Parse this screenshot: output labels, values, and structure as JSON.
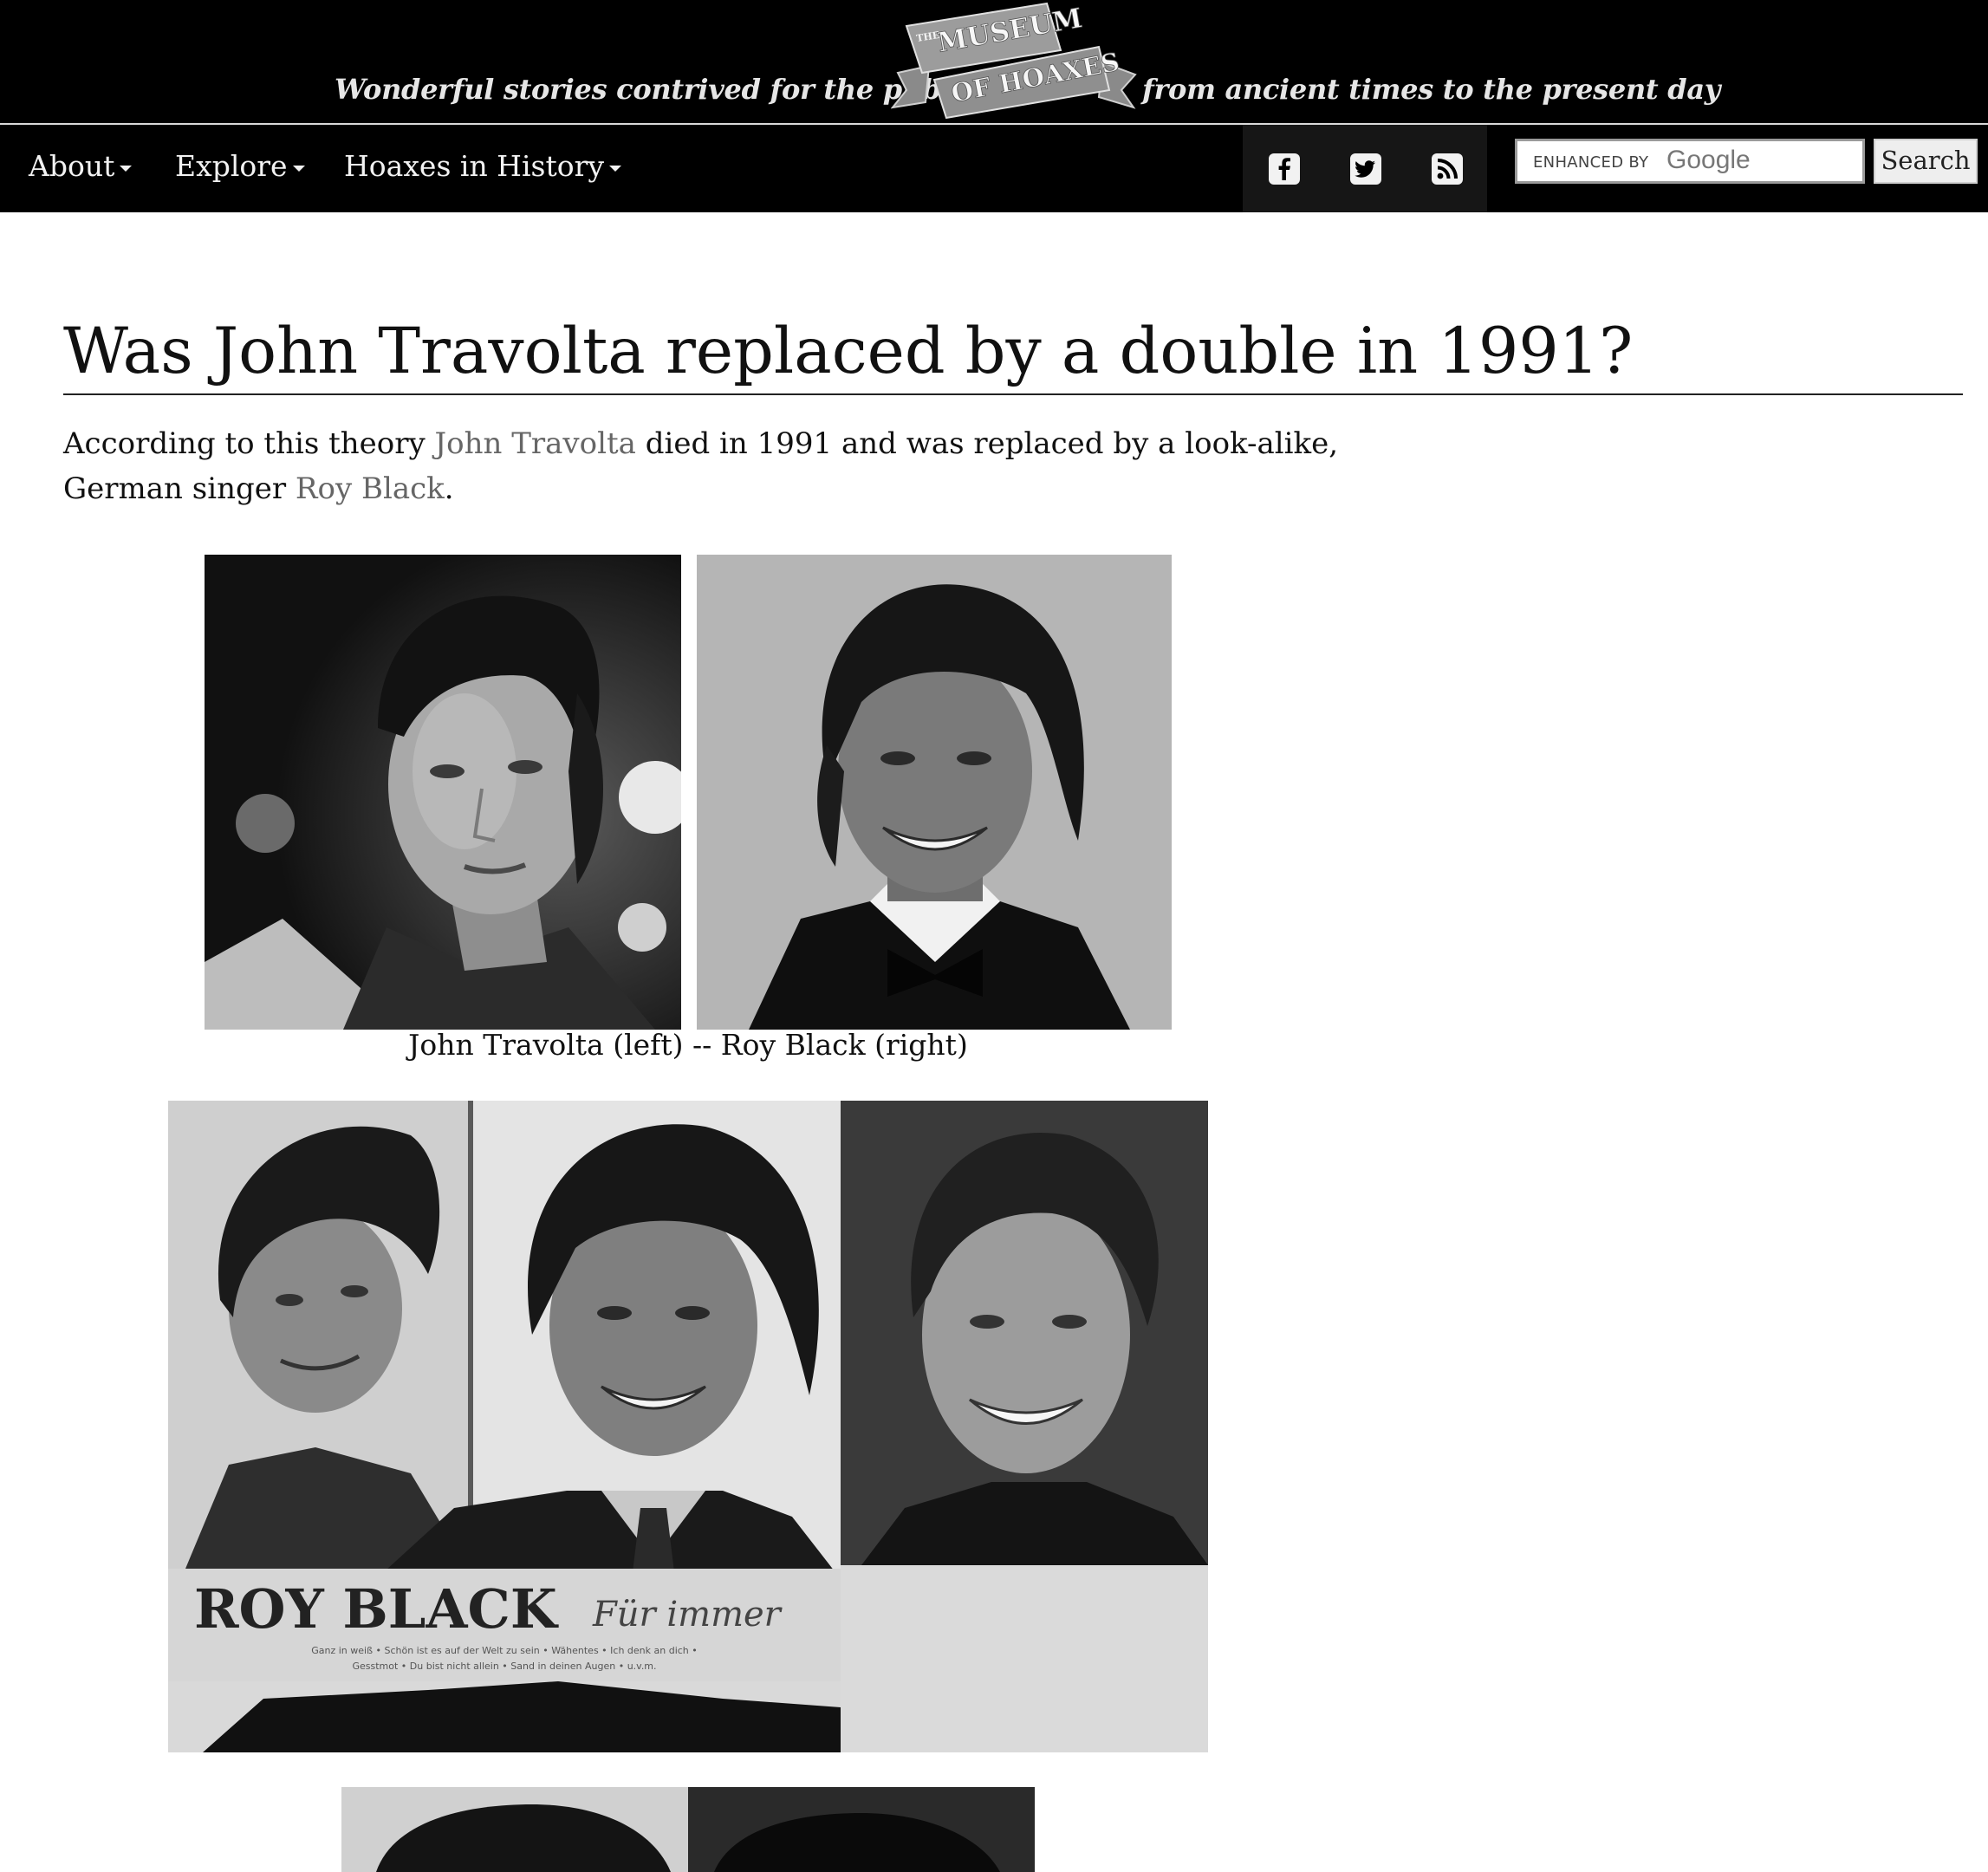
{
  "header": {
    "tagline_left": "Wonderful stories contrived for the public",
    "tagline_right": "from ancient times to the present day",
    "logo_small": "THE",
    "logo_top": "MUSEUM",
    "logo_bottom": "OF HOAXES"
  },
  "nav": {
    "items": [
      {
        "label": "About"
      },
      {
        "label": "Explore"
      },
      {
        "label": "Hoaxes in History"
      }
    ],
    "social": [
      "facebook-icon",
      "twitter-icon",
      "rss-icon"
    ],
    "search": {
      "enhanced_by": "ENHANCED BY",
      "google": "Google",
      "button": "Search"
    }
  },
  "article": {
    "title": "Was John Travolta replaced by a double in 1991?",
    "intro": {
      "part1": "According to this theory ",
      "link1": "John Travolta",
      "part2": " died in 1991 and was replaced by a look-alike,",
      "part3": "German singer ",
      "link2": "Roy Black",
      "part4": "."
    },
    "caption": "John Travolta (left) -- Roy Black (right)",
    "poster_text": {
      "name": "ROY BLACK",
      "script": "Für immer",
      "tracks_line1": "Ganz in weiß • Schön ist es auf der Welt zu sein • Wähentes • Ich denk an dich •",
      "tracks_line2": "Gesstmot • Du bist nicht allein • Sand in deinen Augen • u.v.m."
    }
  },
  "colors": {
    "background": "#ffffff",
    "header_bg": "#000000",
    "link": "#666666"
  }
}
